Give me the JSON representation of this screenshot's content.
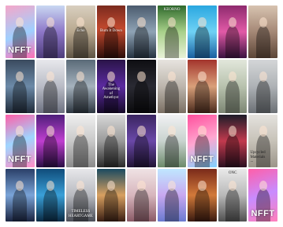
{
  "tiles": [
    {
      "id": "r1c1",
      "label": "NFFT",
      "pos": "bot",
      "style": "big",
      "bg": "linear-gradient(160deg,#f5a6c8 0%,#9fd0ff 55%,#ff6fb5 100%)"
    },
    {
      "id": "r1c2",
      "label": "",
      "pos": "top",
      "style": "",
      "bg": "linear-gradient(180deg,#c9d7f2 0%,#8e77c8 50%,#4e3d7a 100%)"
    },
    {
      "id": "r1c3",
      "label": "Echo",
      "pos": "mid",
      "style": "",
      "bg": "linear-gradient(180deg,#d9cfbf 0%,#b8a88f 50%,#5e5344 100%)"
    },
    {
      "id": "r1c4",
      "label": "Burn It Down",
      "pos": "mid",
      "style": "",
      "bg": "linear-gradient(180deg,#7a2a1e 0%,#c44a2f 45%,#2b0d09 100%)"
    },
    {
      "id": "r1c5",
      "label": "",
      "pos": "top",
      "style": "",
      "bg": "linear-gradient(180deg,#4b5b6e 0%,#8fa3b5 50%,#253240 100%)"
    },
    {
      "id": "r1c6",
      "label": "KEORNO",
      "pos": "top",
      "style": "",
      "bg": "linear-gradient(180deg,#2f6a2c 0%,#a8d08a 50%,#e9f2d8 100%)"
    },
    {
      "id": "r1c7",
      "label": "",
      "pos": "top",
      "style": "",
      "bg": "linear-gradient(180deg,#2aa7e0 0%,#6fd2f5 50%,#1a5fa0 100%)"
    },
    {
      "id": "r1c8",
      "label": "",
      "pos": "top",
      "style": "",
      "bg": "linear-gradient(180deg,#8e2a6e 0%,#e25aa7 50%,#3b1240 100%)"
    },
    {
      "id": "r1c9",
      "label": "",
      "pos": "top",
      "style": "",
      "bg": "linear-gradient(180deg,#d7c3b0 0%,#a58876 50%,#5c4638 100%)"
    },
    {
      "id": "r2c1",
      "label": "",
      "pos": "top",
      "style": "",
      "bg": "linear-gradient(180deg,#3a4a5e 0%,#6c8aa8 50%,#1f2a38 100%)"
    },
    {
      "id": "r2c2",
      "label": "",
      "pos": "bot",
      "style": "",
      "bg": "linear-gradient(180deg,#e8e8ec 0%,#b9bcc6 50%,#6d7180 100%)"
    },
    {
      "id": "r2c3",
      "label": "",
      "pos": "top",
      "style": "",
      "bg": "linear-gradient(180deg,#5a6a78 0%,#a5b2bd 50%,#2d3640 100%)"
    },
    {
      "id": "r2c4",
      "label": "The\nAwakening\nof\nAmethyst",
      "pos": "mid",
      "style": "",
      "bg": "linear-gradient(180deg,#2a1448 0%,#5b2aa0 50%,#160a28 100%)"
    },
    {
      "id": "r2c5",
      "label": "",
      "pos": "top",
      "style": "",
      "bg": "linear-gradient(180deg,#0e0e12 0%,#2a2a33 50%,#0a0a0c 100%)"
    },
    {
      "id": "r2c6",
      "label": "",
      "pos": "top",
      "style": "",
      "bg": "linear-gradient(180deg,#e7e4df 0%,#bdb6ad 50%,#7a6f63 100%)"
    },
    {
      "id": "r2c7",
      "label": "",
      "pos": "top",
      "style": "",
      "bg": "linear-gradient(180deg,#a3342c 0%,#d9a07a 50%,#4a2a1c 100%)"
    },
    {
      "id": "r2c8",
      "label": "",
      "pos": "top",
      "style": "",
      "bg": "linear-gradient(180deg,#e2e7db 0%,#b8c2ae 50%,#7c8673 100%)"
    },
    {
      "id": "r2c9",
      "label": "",
      "pos": "mid",
      "style": "",
      "bg": "linear-gradient(180deg,#d4d6d8 0%,#aeb2b6 50%,#6b7075 100%)"
    },
    {
      "id": "r3c1",
      "label": "NFFT",
      "pos": "bot",
      "style": "big",
      "bg": "linear-gradient(160deg,#ff5fa8 0%,#9fd6ff 50%,#ff8dc6 100%)"
    },
    {
      "id": "r3c2",
      "label": "",
      "pos": "top",
      "style": "",
      "bg": "linear-gradient(180deg,#4e1f7a 0%,#c03fd0 50%,#2a0e45 100%)"
    },
    {
      "id": "r3c3",
      "label": "",
      "pos": "top",
      "style": "",
      "bg": "linear-gradient(180deg,#efefef 0%,#c9c9c9 50%,#8a8a8a 100%)"
    },
    {
      "id": "r3c4",
      "label": "",
      "pos": "bot",
      "style": "",
      "bg": "linear-gradient(180deg,#d8d8d8 0%,#9a9a9a 50%,#2a2a2a 100%)"
    },
    {
      "id": "r3c5",
      "label": "",
      "pos": "mid",
      "style": "",
      "bg": "linear-gradient(180deg,#3a2560 0%,#6a48a8 50%,#201434 100%)"
    },
    {
      "id": "r3c6",
      "label": "",
      "pos": "top",
      "style": "",
      "bg": "linear-gradient(180deg,#f1f1f3 0%,#c9d3cf 50%,#6c8a6a 100%)"
    },
    {
      "id": "r3c7",
      "label": "NFFT",
      "pos": "bot",
      "style": "big",
      "bg": "linear-gradient(160deg,#ff4f9c 0%,#ffa7d0 50%,#7fd0ff 100%)"
    },
    {
      "id": "r3c8",
      "label": "",
      "pos": "top",
      "style": "",
      "bg": "linear-gradient(180deg,#1c1c28 0%,#c23a4e 50%,#2b1020 100%)"
    },
    {
      "id": "r3c9",
      "label": "Upcycled\nMaterials\n...",
      "pos": "bot",
      "style": "dark-left",
      "bg": "linear-gradient(180deg,#e4e2de 0%,#c7c2b8 50%,#9c958a 100%)"
    },
    {
      "id": "r4c1",
      "label": "",
      "pos": "bot",
      "style": "",
      "bg": "linear-gradient(180deg,#2a3f68 0%,#7aa4d8 50%,#1a2440 100%)"
    },
    {
      "id": "r4c2",
      "label": "",
      "pos": "top",
      "style": "",
      "bg": "linear-gradient(180deg,#0f4c7a 0%,#3aa0d8 50%,#0a2a44 100%)"
    },
    {
      "id": "r4c3",
      "label": "TIMELESS\nHEARTGAME",
      "pos": "bot",
      "style": "",
      "bg": "linear-gradient(180deg,#e7e7ea 0%,#b8bac0 50%,#4c4f58 100%)"
    },
    {
      "id": "r4c4",
      "label": "",
      "pos": "bot",
      "style": "",
      "bg": "linear-gradient(180deg,#1a4a60 0%,#d8a060 50%,#3a1f14 100%)"
    },
    {
      "id": "r4c5",
      "label": "",
      "pos": "top",
      "style": "",
      "bg": "linear-gradient(180deg,#efe2e4 0%,#d7b6bd 50%,#8a5a66 100%)"
    },
    {
      "id": "r4c6",
      "label": "",
      "pos": "top",
      "style": "",
      "bg": "linear-gradient(180deg,#bfe7ff 0%,#c8a8f0 50%,#6a7ad0 100%)"
    },
    {
      "id": "r4c7",
      "label": "",
      "pos": "top",
      "style": "",
      "bg": "linear-gradient(180deg,#7a2a1a 0%,#d27a3a 50%,#3a1a10 100%)"
    },
    {
      "id": "r4c8",
      "label": "ONC",
      "pos": "top",
      "style": "dark",
      "bg": "linear-gradient(180deg,#e9e9e9 0%,#b9b9b9 50%,#505050 100%)"
    },
    {
      "id": "r4c9",
      "label": "NFFT",
      "pos": "bot",
      "style": "big",
      "bg": "linear-gradient(160deg,#ff5ea8 0%,#c88cff 50%,#ff7fba 100%)"
    }
  ]
}
